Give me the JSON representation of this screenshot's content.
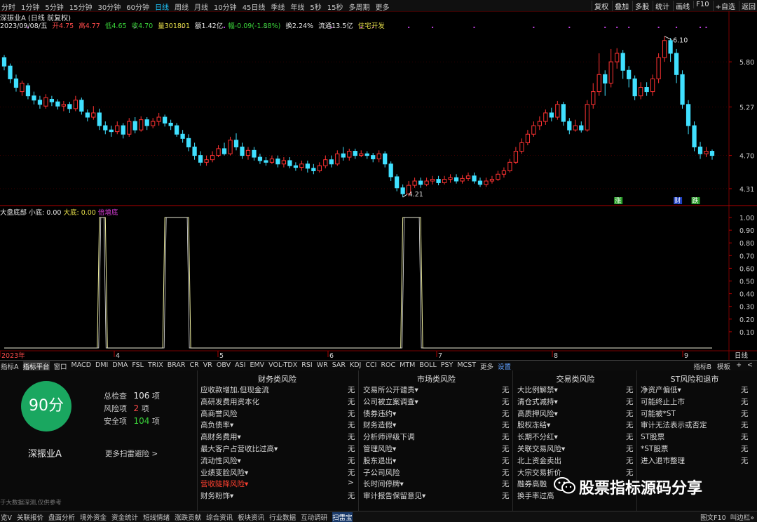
{
  "toolbar": {
    "periods": [
      {
        "label": "分时",
        "active": false
      },
      {
        "label": "1分钟",
        "active": false
      },
      {
        "label": "5分钟",
        "active": false
      },
      {
        "label": "15分钟",
        "active": false
      },
      {
        "label": "30分钟",
        "active": false
      },
      {
        "label": "60分钟",
        "active": false
      },
      {
        "label": "日线",
        "active": true
      },
      {
        "label": "周线",
        "active": false
      },
      {
        "label": "月线",
        "active": false
      },
      {
        "label": "10分钟",
        "active": false
      },
      {
        "label": "45日线",
        "active": false
      },
      {
        "label": "季线",
        "active": false
      },
      {
        "label": "年线",
        "active": false
      },
      {
        "label": "5秒",
        "active": false
      },
      {
        "label": "15秒",
        "active": false
      },
      {
        "label": "多周期",
        "active": false
      },
      {
        "label": "更多",
        "active": false
      }
    ],
    "right": [
      "复权",
      "叠加",
      "多股",
      "统计",
      "画线",
      "F10",
      "+自选",
      "返回"
    ]
  },
  "stock": {
    "title": "深振业A (日线 前复权)",
    "date": "2023/09/08/五",
    "open": "开4.75",
    "high": "高4.77",
    "low": "低4.65",
    "close": "收4.70",
    "volume": "量301801",
    "amount": "额1.42亿",
    "change": "幅-0.09(-1.88%)",
    "turnover": "换2.24%",
    "float": "流通13.5亿",
    "tag": "住宅开发"
  },
  "chart_data": {
    "type": "candlestick",
    "price_ticks": [
      "5.80",
      "5.27",
      "4.70",
      "4.31"
    ],
    "price_range": [
      4.21,
      6.1
    ],
    "high_annotation": "6.10",
    "low_annotation": "4.21",
    "candles": [
      [
        5.85,
        5.75,
        5.88,
        5.7
      ],
      [
        5.75,
        5.6,
        5.78,
        5.55
      ],
      [
        5.6,
        5.5,
        5.65,
        5.45
      ],
      [
        5.45,
        5.55,
        5.58,
        5.4
      ],
      [
        5.52,
        5.4,
        5.55,
        5.36
      ],
      [
        5.4,
        5.35,
        5.45,
        5.3
      ],
      [
        5.35,
        5.3,
        5.4,
        5.25
      ],
      [
        5.28,
        5.38,
        5.42,
        5.25
      ],
      [
        5.36,
        5.33,
        5.4,
        5.28
      ],
      [
        5.33,
        5.28,
        5.36,
        5.24
      ],
      [
        5.28,
        5.3,
        5.34,
        5.22
      ],
      [
        5.3,
        5.25,
        5.33,
        5.2
      ],
      [
        5.25,
        5.35,
        5.4,
        5.22
      ],
      [
        5.35,
        5.22,
        5.38,
        5.18
      ],
      [
        5.2,
        5.15,
        5.24,
        5.1
      ],
      [
        5.15,
        5.2,
        5.28,
        5.12
      ],
      [
        5.2,
        5.05,
        5.25,
        5.0
      ],
      [
        5.05,
        5.0,
        5.1,
        4.95
      ],
      [
        5.0,
        4.98,
        5.05,
        4.92
      ],
      [
        4.98,
        5.05,
        5.1,
        4.95
      ],
      [
        5.05,
        4.95,
        5.08,
        4.9
      ],
      [
        4.95,
        5.1,
        5.14,
        4.92
      ],
      [
        5.1,
        5.0,
        5.15,
        4.96
      ],
      [
        5.0,
        5.12,
        5.16,
        4.98
      ],
      [
        5.12,
        5.05,
        5.15,
        5.0
      ],
      [
        5.05,
        5.1,
        5.14,
        5.02
      ],
      [
        5.1,
        5.15,
        5.2,
        5.05
      ],
      [
        5.15,
        5.08,
        5.18,
        5.04
      ],
      [
        5.08,
        5.05,
        5.12,
        5.0
      ],
      [
        5.05,
        4.95,
        5.08,
        4.92
      ],
      [
        4.95,
        4.9,
        5.0,
        4.85
      ],
      [
        4.9,
        4.8,
        4.95,
        4.75
      ],
      [
        4.8,
        4.7,
        4.85,
        4.65
      ],
      [
        4.7,
        4.62,
        4.75,
        4.58
      ],
      [
        4.62,
        4.65,
        4.7,
        4.58
      ],
      [
        4.65,
        4.7,
        4.75,
        4.62
      ],
      [
        4.7,
        4.78,
        4.82,
        4.68
      ],
      [
        4.78,
        4.72,
        4.85,
        4.7
      ],
      [
        4.72,
        4.88,
        4.92,
        4.7
      ],
      [
        4.88,
        4.8,
        4.96,
        4.76
      ],
      [
        4.8,
        4.7,
        4.85,
        4.66
      ],
      [
        4.7,
        4.76,
        4.8,
        4.65
      ],
      [
        4.76,
        4.68,
        4.8,
        4.64
      ],
      [
        4.68,
        4.64,
        4.72,
        4.6
      ],
      [
        4.64,
        4.62,
        4.68,
        4.58
      ],
      [
        4.62,
        4.66,
        4.7,
        4.6
      ],
      [
        4.66,
        4.6,
        4.7,
        4.56
      ],
      [
        4.6,
        4.64,
        4.68,
        4.56
      ],
      [
        4.64,
        4.58,
        4.68,
        4.55
      ],
      [
        4.58,
        4.56,
        4.62,
        4.52
      ],
      [
        4.56,
        4.6,
        4.64,
        4.52
      ],
      [
        4.6,
        4.55,
        4.64,
        4.5
      ],
      [
        4.55,
        4.52,
        4.6,
        4.48
      ],
      [
        4.52,
        4.58,
        4.62,
        4.5
      ],
      [
        4.58,
        4.65,
        4.7,
        4.55
      ],
      [
        4.65,
        4.6,
        4.7,
        4.56
      ],
      [
        4.6,
        4.72,
        4.76,
        4.58
      ],
      [
        4.72,
        4.68,
        4.8,
        4.64
      ],
      [
        4.68,
        4.75,
        4.78,
        4.64
      ],
      [
        4.75,
        4.7,
        4.78,
        4.66
      ],
      [
        4.7,
        4.72,
        4.76,
        4.68
      ],
      [
        4.72,
        4.7,
        4.75,
        4.66
      ],
      [
        4.7,
        4.66,
        4.73,
        4.62
      ],
      [
        4.66,
        4.72,
        4.76,
        4.62
      ],
      [
        4.72,
        4.6,
        4.75,
        4.56
      ],
      [
        4.6,
        4.45,
        4.63,
        4.4
      ],
      [
        4.45,
        4.32,
        4.48,
        4.28
      ],
      [
        4.32,
        4.25,
        4.36,
        4.21
      ],
      [
        4.25,
        4.35,
        4.4,
        4.22
      ],
      [
        4.35,
        4.4,
        4.44,
        4.32
      ],
      [
        4.4,
        4.36,
        4.44,
        4.32
      ],
      [
        4.36,
        4.4,
        4.44,
        4.34
      ],
      [
        4.4,
        4.42,
        4.46,
        4.36
      ],
      [
        4.42,
        4.38,
        4.46,
        4.35
      ],
      [
        4.38,
        4.42,
        4.46,
        4.36
      ],
      [
        4.42,
        4.44,
        4.48,
        4.38
      ],
      [
        4.44,
        4.4,
        4.48,
        4.37
      ],
      [
        4.4,
        4.43,
        4.47,
        4.37
      ],
      [
        4.43,
        4.46,
        4.5,
        4.4
      ],
      [
        4.46,
        4.4,
        4.5,
        4.37
      ],
      [
        4.4,
        4.36,
        4.44,
        4.33
      ],
      [
        4.36,
        4.4,
        4.44,
        4.33
      ],
      [
        4.4,
        4.42,
        4.46,
        4.37
      ],
      [
        4.42,
        4.48,
        4.52,
        4.4
      ],
      [
        4.48,
        4.52,
        4.56,
        4.44
      ],
      [
        4.52,
        4.62,
        4.66,
        4.5
      ],
      [
        4.62,
        4.75,
        4.8,
        4.6
      ],
      [
        4.75,
        4.85,
        4.9,
        4.72
      ],
      [
        4.85,
        4.95,
        5.0,
        4.82
      ],
      [
        4.95,
        5.05,
        5.1,
        4.92
      ],
      [
        5.05,
        5.1,
        5.16,
        5.0
      ],
      [
        5.1,
        5.2,
        5.24,
        5.06
      ],
      [
        5.2,
        5.15,
        5.26,
        5.1
      ],
      [
        5.15,
        5.3,
        5.34,
        5.12
      ],
      [
        5.3,
        5.1,
        5.33,
        5.05
      ],
      [
        5.1,
        5.0,
        5.14,
        4.95
      ],
      [
        5.0,
        5.05,
        5.12,
        4.98
      ],
      [
        5.05,
        5.0,
        5.1,
        4.97
      ],
      [
        5.0,
        5.3,
        5.35,
        4.98
      ],
      [
        5.3,
        5.45,
        5.55,
        5.25
      ],
      [
        5.45,
        5.65,
        5.9,
        5.4
      ],
      [
        5.65,
        5.55,
        5.7,
        5.4
      ],
      [
        5.55,
        5.8,
        5.95,
        5.5
      ],
      [
        5.8,
        5.9,
        5.96,
        5.72
      ],
      [
        5.9,
        5.7,
        5.94,
        5.6
      ],
      [
        5.7,
        5.6,
        5.75,
        5.5
      ],
      [
        5.6,
        5.4,
        5.64,
        5.35
      ],
      [
        5.4,
        5.5,
        5.56,
        5.36
      ],
      [
        5.5,
        5.45,
        5.56,
        5.4
      ],
      [
        5.45,
        5.6,
        5.65,
        5.4
      ],
      [
        5.6,
        5.85,
        5.9,
        5.55
      ],
      [
        5.85,
        6.05,
        6.1,
        5.8
      ],
      [
        6.05,
        5.9,
        6.08,
        5.8
      ],
      [
        5.9,
        5.65,
        5.95,
        5.55
      ],
      [
        5.65,
        5.3,
        5.7,
        5.25
      ],
      [
        5.3,
        5.05,
        5.35,
        4.95
      ],
      [
        5.05,
        4.8,
        5.1,
        4.75
      ],
      [
        4.8,
        4.72,
        4.86,
        4.66
      ],
      [
        4.72,
        4.75,
        4.8,
        4.68
      ],
      [
        4.75,
        4.7,
        4.77,
        4.65
      ]
    ],
    "markers": [
      "涨",
      "财",
      "跌"
    ],
    "indicator": {
      "name": "大盘底部",
      "label_small": "小底:",
      "val_small": "0.00",
      "label_big": "大底:",
      "val_big": "0.00",
      "tag": "倍增底",
      "y_ticks": [
        "1.00",
        "0.90",
        "0.80",
        "0.70",
        "0.60",
        "0.50",
        "0.40",
        "0.30",
        "0.20",
        "0.10"
      ],
      "pulses": [
        [
          16,
          17
        ],
        [
          27,
          31
        ],
        [
          67,
          70
        ]
      ]
    },
    "x_labels": [
      "2023年",
      "4",
      "5",
      "6",
      "7",
      "8",
      "9"
    ],
    "x_label_right": "日线"
  },
  "tabs": {
    "items": [
      "指标A",
      "指标平台",
      "窗口",
      "MACD",
      "DMI",
      "DMA",
      "FSL",
      "TRIX",
      "BRAR",
      "CR",
      "VR",
      "OBV",
      "ASI",
      "EMV",
      "VOL-TDX",
      "RSI",
      "WR",
      "SAR",
      "KDJ",
      "CCI",
      "ROC",
      "MTM",
      "BOLL",
      "PSY",
      "MCST",
      "更多",
      "设置"
    ],
    "right": [
      "指标B",
      "模板",
      "+",
      "<"
    ]
  },
  "risk": {
    "score": "90分",
    "stock_name": "深振业A",
    "total_label": "总检查",
    "total_value": "106",
    "risk_label": "风险项",
    "risk_value": "2",
    "safe_label": "安全项",
    "safe_value": "104",
    "unit": "项",
    "more_scan": "更多扫雷避险 >",
    "footer_note": "于大数据深测,仅供参考",
    "columns": [
      {
        "title": "财务类风险",
        "rows": [
          {
            "label": "应收款增加,但现金流",
            "value": "无",
            "hl": false
          },
          {
            "label": "高研发费用资本化",
            "value": "无",
            "hl": false
          },
          {
            "label": "高商誉风险",
            "value": "无",
            "hl": false
          },
          {
            "label": "高负债率▾",
            "value": "无",
            "hl": false
          },
          {
            "label": "高财务费用▾",
            "value": "无",
            "hl": false
          },
          {
            "label": "最大客户占营收比过高▾",
            "value": "无",
            "hl": false
          },
          {
            "label": "流动性风险▾",
            "value": "无",
            "hl": false
          },
          {
            "label": "业绩变脸风险▾",
            "value": "无",
            "hl": false
          },
          {
            "label": "营收陡降风险▾",
            "value": ">",
            "hl": true
          },
          {
            "label": "财务粉饰▾",
            "value": "无",
            "hl": false
          }
        ]
      },
      {
        "title": "市场类风险",
        "rows": [
          {
            "label": "交易所公开谴责▾",
            "value": "无",
            "hl": false
          },
          {
            "label": "公司被立案调查▾",
            "value": "无",
            "hl": false
          },
          {
            "label": "债券违约▾",
            "value": "无",
            "hl": false
          },
          {
            "label": "财务造假▾",
            "value": "无",
            "hl": false
          },
          {
            "label": "分析师评级下调",
            "value": "无",
            "hl": false
          },
          {
            "label": "管理风险▾",
            "value": "无",
            "hl": false
          },
          {
            "label": "股东退出▾",
            "value": "无",
            "hl": false
          },
          {
            "label": "子公司风险",
            "value": "无",
            "hl": false
          },
          {
            "label": "长时间停牌▾",
            "value": "无",
            "hl": false
          },
          {
            "label": "审计报告保留意见▾",
            "value": "无",
            "hl": false
          }
        ]
      },
      {
        "title": "交易类风险",
        "rows": [
          {
            "label": "大比例解禁▾",
            "value": "无",
            "hl": false
          },
          {
            "label": "清仓式减持▾",
            "value": "无",
            "hl": false
          },
          {
            "label": "高质押风险▾",
            "value": "无",
            "hl": false
          },
          {
            "label": "股权冻结▾",
            "value": "无",
            "hl": false
          },
          {
            "label": "长期不分红▾",
            "value": "无",
            "hl": false
          },
          {
            "label": "关联交易风险▾",
            "value": "无",
            "hl": false
          },
          {
            "label": "北上资金卖出",
            "value": "无",
            "hl": false
          },
          {
            "label": "大宗交易折价",
            "value": "无",
            "hl": false
          },
          {
            "label": "融券高融",
            "value": "",
            "hl": false
          },
          {
            "label": "换手率过高",
            "value": "",
            "hl": false
          }
        ]
      },
      {
        "title": "ST风险和退市",
        "rows": [
          {
            "label": "净资产偏低▾",
            "value": "无",
            "hl": false
          },
          {
            "label": "可能终止上市",
            "value": "无",
            "hl": false
          },
          {
            "label": "可能被*ST",
            "value": "无",
            "hl": false
          },
          {
            "label": "审计无法表示或否定",
            "value": "无",
            "hl": false
          },
          {
            "label": "ST股票",
            "value": "无",
            "hl": false
          },
          {
            "label": "*ST股票",
            "value": "无",
            "hl": false
          },
          {
            "label": "进入退市整理",
            "value": "无",
            "hl": false
          }
        ]
      }
    ]
  },
  "watermark": {
    "text": "股票指标源码分享"
  },
  "statusbar": {
    "items": [
      "览V",
      "关联报价",
      "盘面分析",
      "境外资金",
      "资金统计",
      "短线情绪",
      "涨跌贡献",
      "综合资讯",
      "板块资讯",
      "行业数据",
      "互动调研",
      "扫雷宝"
    ],
    "active_index": 11,
    "right": [
      "图文F10",
      "叫边栏»"
    ]
  },
  "colors": {
    "up": "#ff3232",
    "down": "#40e0ff",
    "line": "#f0f0a0",
    "grid": "#5a0000",
    "score": "#1aa760"
  }
}
